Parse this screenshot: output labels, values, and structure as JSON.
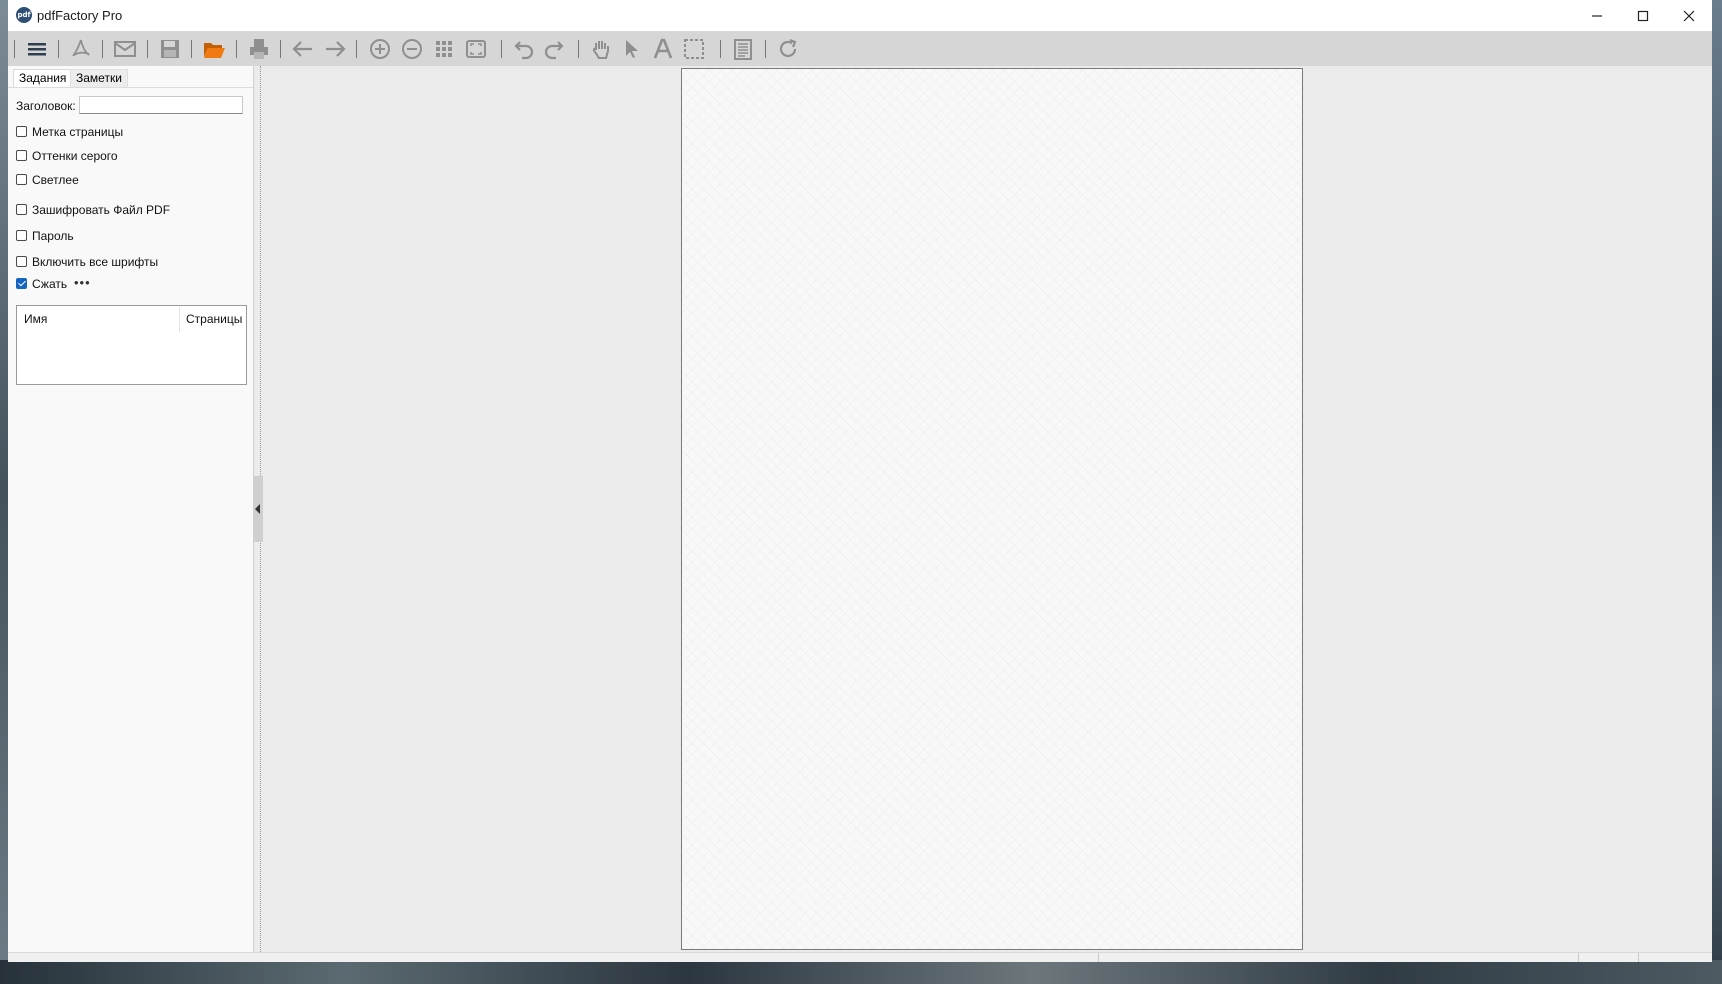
{
  "window": {
    "title": "pdfFactory Pro",
    "app_icon_text": "pdf",
    "controls": [
      "minimize-icon",
      "maximize-icon",
      "close-icon"
    ]
  },
  "toolbar": {
    "buttons": [
      {
        "name": "menu",
        "icon": "hamburger-icon",
        "enabled": true
      },
      {
        "name": "pdf-view",
        "icon": "acrobat-icon",
        "enabled": false
      },
      {
        "name": "email",
        "icon": "envelope-icon",
        "enabled": false
      },
      {
        "name": "save",
        "icon": "floppy-icon",
        "enabled": false
      },
      {
        "name": "open",
        "icon": "folder-open-icon",
        "enabled": true
      },
      {
        "name": "print",
        "icon": "printer-icon",
        "enabled": false
      },
      {
        "name": "back",
        "icon": "arrow-left-icon",
        "enabled": false
      },
      {
        "name": "forward",
        "icon": "arrow-right-icon",
        "enabled": false
      },
      {
        "name": "zoom-in",
        "icon": "zoom-in-icon",
        "enabled": false
      },
      {
        "name": "zoom-out",
        "icon": "zoom-out-icon",
        "enabled": false
      },
      {
        "name": "thumbnails",
        "icon": "grid-icon",
        "enabled": false
      },
      {
        "name": "fit-page",
        "icon": "fit-page-icon",
        "enabled": false
      },
      {
        "name": "undo",
        "icon": "undo-icon",
        "enabled": false
      },
      {
        "name": "redo",
        "icon": "redo-icon",
        "enabled": false
      },
      {
        "name": "hand",
        "icon": "hand-icon",
        "enabled": false
      },
      {
        "name": "select",
        "icon": "pointer-icon",
        "enabled": false
      },
      {
        "name": "text",
        "icon": "text-icon",
        "enabled": false
      },
      {
        "name": "marquee",
        "icon": "marquee-select-icon",
        "enabled": false
      },
      {
        "name": "notes",
        "icon": "notepad-icon",
        "enabled": false
      },
      {
        "name": "refresh",
        "icon": "refresh-icon",
        "enabled": false
      }
    ],
    "colors": {
      "enabled": "#2f3f4f",
      "disabled": "#8f8f8f",
      "open_folder": "#f07a12"
    }
  },
  "left_panel": {
    "tabs": [
      {
        "label": "Задания",
        "active": true
      },
      {
        "label": "Заметки",
        "active": false
      }
    ],
    "title_label": "Заголовок:",
    "title_value": "",
    "checkboxes": [
      {
        "label": "Метка страницы",
        "checked": false
      },
      {
        "label": "Оттенки серого",
        "checked": false
      },
      {
        "label": "Светлее",
        "checked": false
      },
      {
        "label": "Зашифровать Файл PDF",
        "checked": false
      },
      {
        "label": "Пароль",
        "checked": false
      },
      {
        "label": "Включить все шрифты",
        "checked": false
      },
      {
        "label": "Сжать",
        "checked": true
      }
    ],
    "more_label": "•••",
    "list": {
      "columns": [
        "Имя",
        "Страницы"
      ],
      "rows": []
    }
  }
}
